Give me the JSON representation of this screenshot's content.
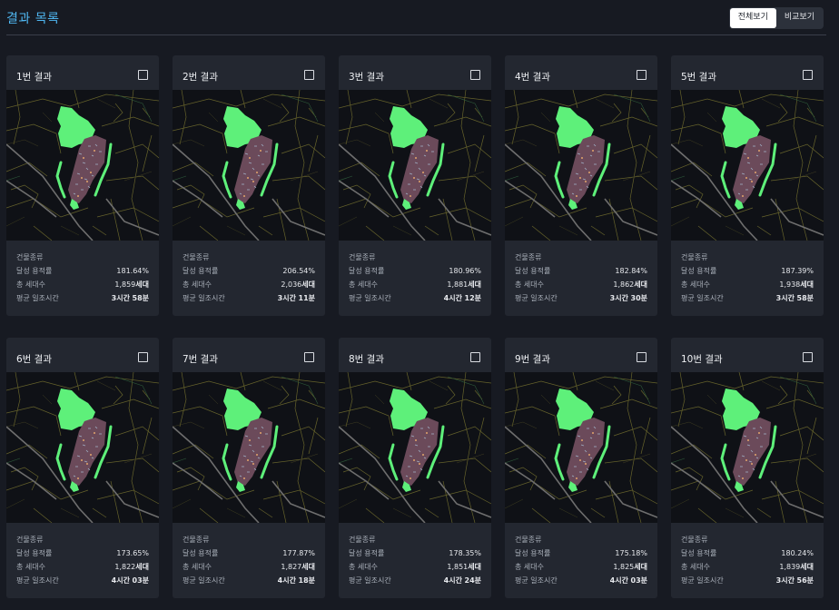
{
  "header": {
    "title": "결과 목록",
    "view_all_label": "전체보기",
    "compare_label": "비교보기"
  },
  "labels": {
    "building_type": "건물종류",
    "far": "달성 용적률",
    "households": "총 세대수",
    "sunlight": "평균 일조시간"
  },
  "colors": {
    "accent": "#4fb6f0",
    "park": "#5ef07a",
    "site": "#6b4a5a"
  },
  "results": [
    {
      "name": "1번 결과",
      "far": "181.64%",
      "households": "1,859",
      "households_unit": "세대",
      "hours": "3시간",
      "minutes": "58분"
    },
    {
      "name": "2번 결과",
      "far": "206.54%",
      "households": "2,036",
      "households_unit": "세대",
      "hours": "3시간",
      "minutes": "11분"
    },
    {
      "name": "3번 결과",
      "far": "180.96%",
      "households": "1,881",
      "households_unit": "세대",
      "hours": "4시간",
      "minutes": "12분"
    },
    {
      "name": "4번 결과",
      "far": "182.84%",
      "households": "1,862",
      "households_unit": "세대",
      "hours": "3시간",
      "minutes": "30분"
    },
    {
      "name": "5번 결과",
      "far": "187.39%",
      "households": "1,938",
      "households_unit": "세대",
      "hours": "3시간",
      "minutes": "58분"
    },
    {
      "name": "6번 결과",
      "far": "173.65%",
      "households": "1,822",
      "households_unit": "세대",
      "hours": "4시간",
      "minutes": "03분"
    },
    {
      "name": "7번 결과",
      "far": "177.87%",
      "households": "1,827",
      "households_unit": "세대",
      "hours": "4시간",
      "minutes": "18분"
    },
    {
      "name": "8번 결과",
      "far": "178.35%",
      "households": "1,851",
      "households_unit": "세대",
      "hours": "4시간",
      "minutes": "24분"
    },
    {
      "name": "9번 결과",
      "far": "175.18%",
      "households": "1,825",
      "households_unit": "세대",
      "hours": "4시간",
      "minutes": "03분"
    },
    {
      "name": "10번 결과",
      "far": "180.24%",
      "households": "1,839",
      "households_unit": "세대",
      "hours": "3시간",
      "minutes": "56분"
    }
  ]
}
